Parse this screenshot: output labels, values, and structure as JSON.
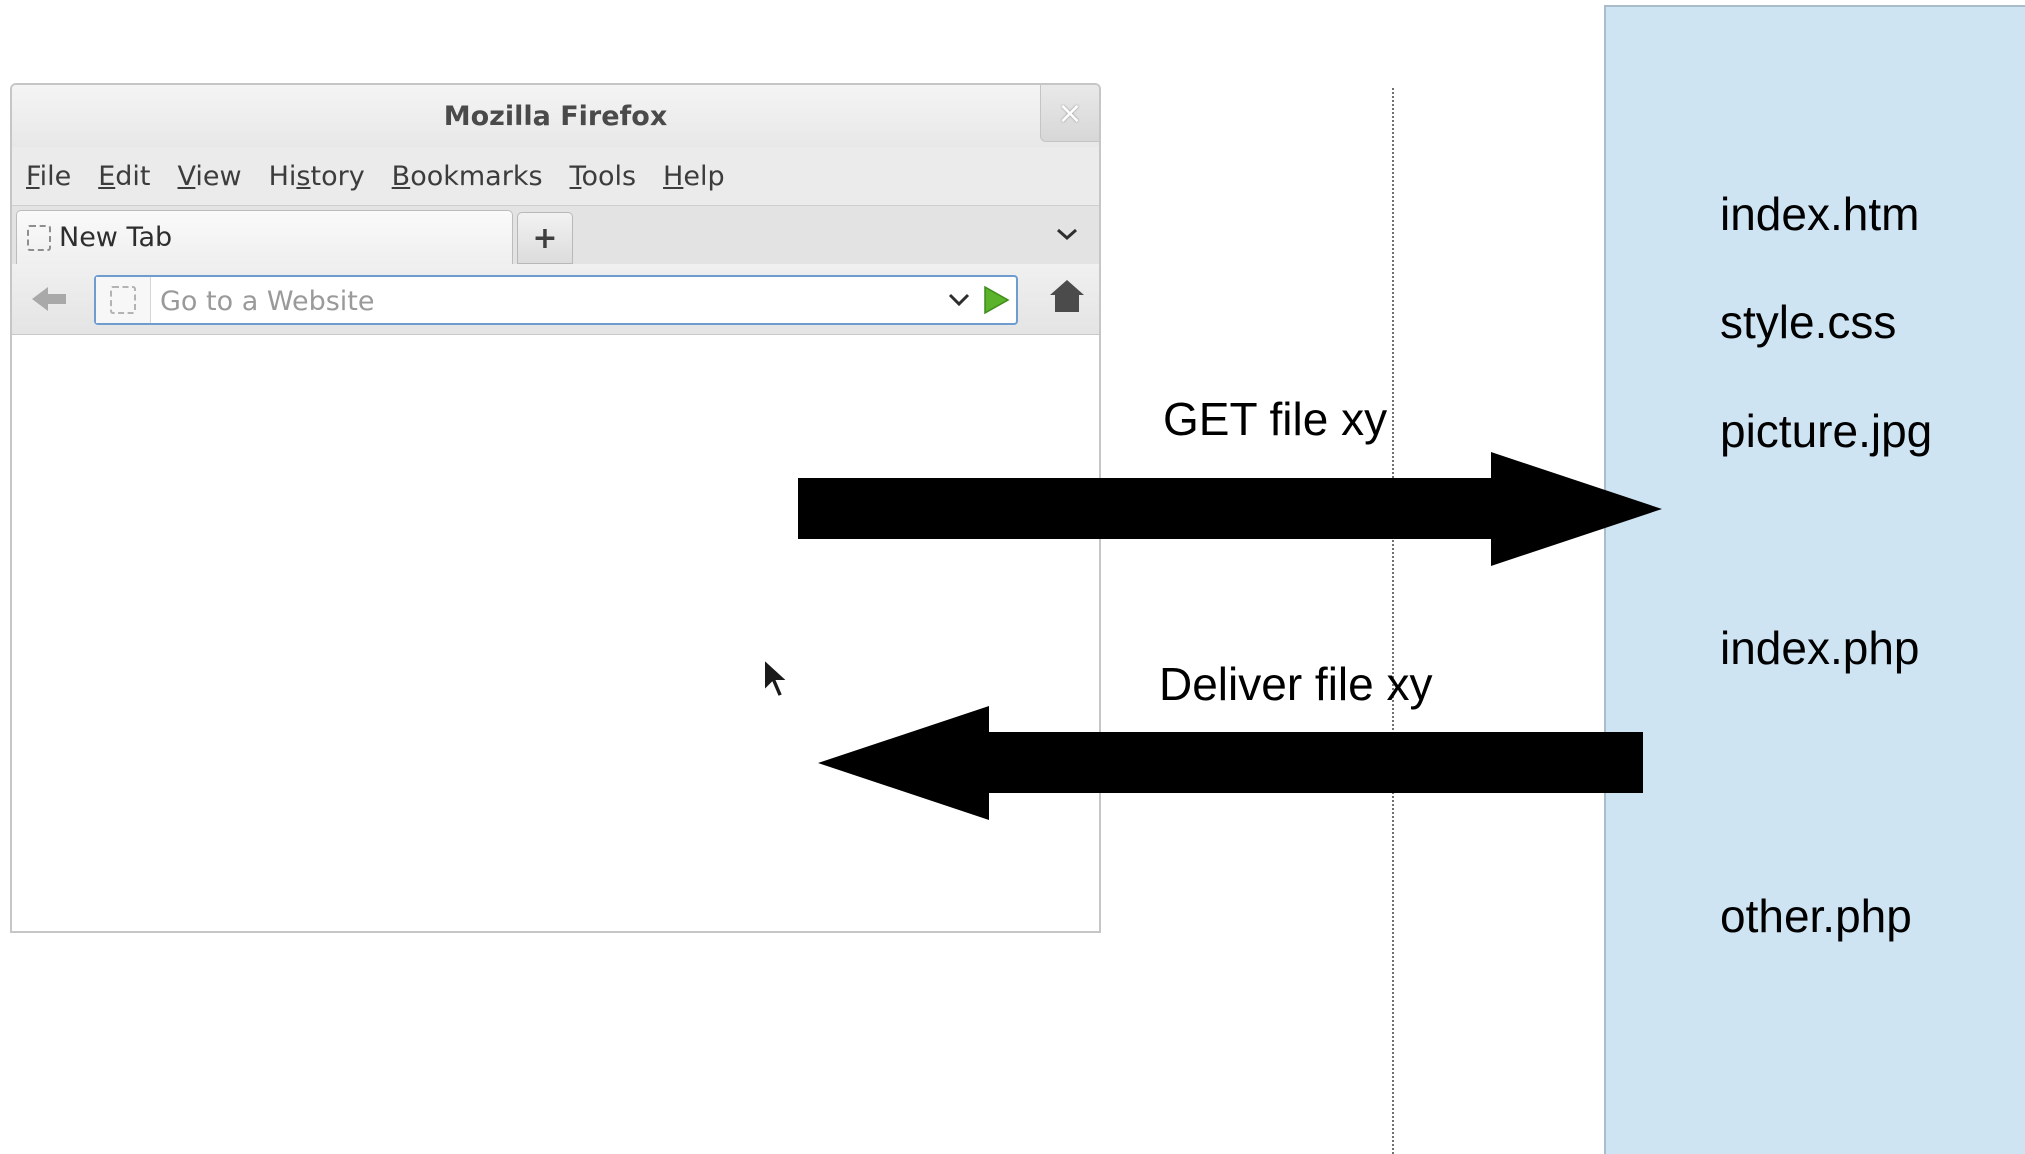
{
  "browser": {
    "title": "Mozilla Firefox",
    "close_symbol": "×",
    "menu": [
      "File",
      "Edit",
      "View",
      "History",
      "Bookmarks",
      "Tools",
      "Help"
    ],
    "tab_label": "New Tab",
    "new_tab_symbol": "+",
    "url_placeholder": "Go to a Website",
    "url_value": ""
  },
  "diagram": {
    "request_label": "GET file xy",
    "response_label": "Deliver file xy",
    "server_files": [
      "index.htm",
      "style.css",
      "picture.jpg",
      "index.php",
      "other.php"
    ]
  },
  "colors": {
    "server_panel": "#cfe4f3",
    "arrow": "#000000",
    "go_arrow": "#5ab32a"
  },
  "icons": [
    "close-icon",
    "back-arrow-icon",
    "page-icon",
    "chevron-down-icon",
    "go-arrow-icon",
    "home-icon",
    "mouse-cursor-icon"
  ]
}
